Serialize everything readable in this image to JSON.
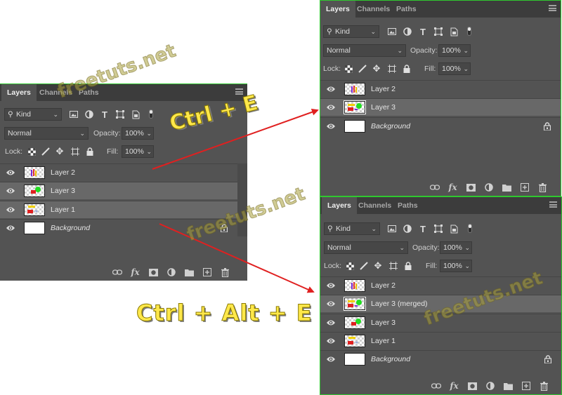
{
  "watermark": "freetuts.net",
  "annotations": {
    "ctrl_e": "Ctrl + E",
    "ctrl_alt_e": "Ctrl + Alt + E"
  },
  "colors": {
    "panel_bg": "#535353",
    "tab_bar": "#3c3c3c",
    "selected_row": "#686868",
    "green_border": "#2fc82f",
    "arrow": "#e02020",
    "annotation": "#ffe84a"
  },
  "tabs": [
    "Layers",
    "Channels",
    "Paths"
  ],
  "filter": {
    "kind_label": "Kind",
    "icons": [
      "image-filter-icon",
      "adjustment-filter-icon",
      "type-filter-icon",
      "shape-filter-icon",
      "smart-object-filter-icon"
    ]
  },
  "blend_mode": "Normal",
  "opacity": {
    "label": "Opacity:",
    "value": "100%"
  },
  "lock": {
    "label": "Lock:",
    "icons": [
      "lock-transparent-icon",
      "lock-image-icon",
      "lock-position-icon",
      "lock-artboard-icon",
      "lock-all-icon"
    ]
  },
  "fill": {
    "label": "Fill:",
    "value": "100%"
  },
  "footer_icons": [
    "link-icon",
    "fx-icon",
    "mask-icon",
    "adjustment-layer-icon",
    "group-folder-icon",
    "new-layer-icon",
    "trash-icon"
  ],
  "panels": [
    {
      "id": "original",
      "layers": [
        {
          "name": "Layer 2",
          "thumb": "layer2",
          "selected": false
        },
        {
          "name": "Layer 3",
          "thumb": "layer3",
          "selected": true
        },
        {
          "name": "Layer 1",
          "thumb": "layer1",
          "selected": true
        },
        {
          "name": "Background",
          "thumb": "white",
          "selected": false,
          "locked": true,
          "italic": true
        }
      ]
    },
    {
      "id": "after-ctrl-e",
      "layers": [
        {
          "name": "Layer 2",
          "thumb": "layer2",
          "selected": false
        },
        {
          "name": "Layer 3",
          "thumb": "merged",
          "selected": true
        },
        {
          "name": "Background",
          "thumb": "white",
          "selected": false,
          "locked": true,
          "italic": true
        }
      ]
    },
    {
      "id": "after-ctrl-alt-e",
      "layers": [
        {
          "name": "Layer 2",
          "thumb": "layer2",
          "selected": false
        },
        {
          "name": "Layer 3 (merged)",
          "thumb": "merged",
          "selected": true
        },
        {
          "name": "Layer 3",
          "thumb": "layer3",
          "selected": false
        },
        {
          "name": "Layer 1",
          "thumb": "layer1",
          "selected": false
        },
        {
          "name": "Background",
          "thumb": "white",
          "selected": false,
          "locked": true,
          "italic": true
        }
      ]
    }
  ]
}
